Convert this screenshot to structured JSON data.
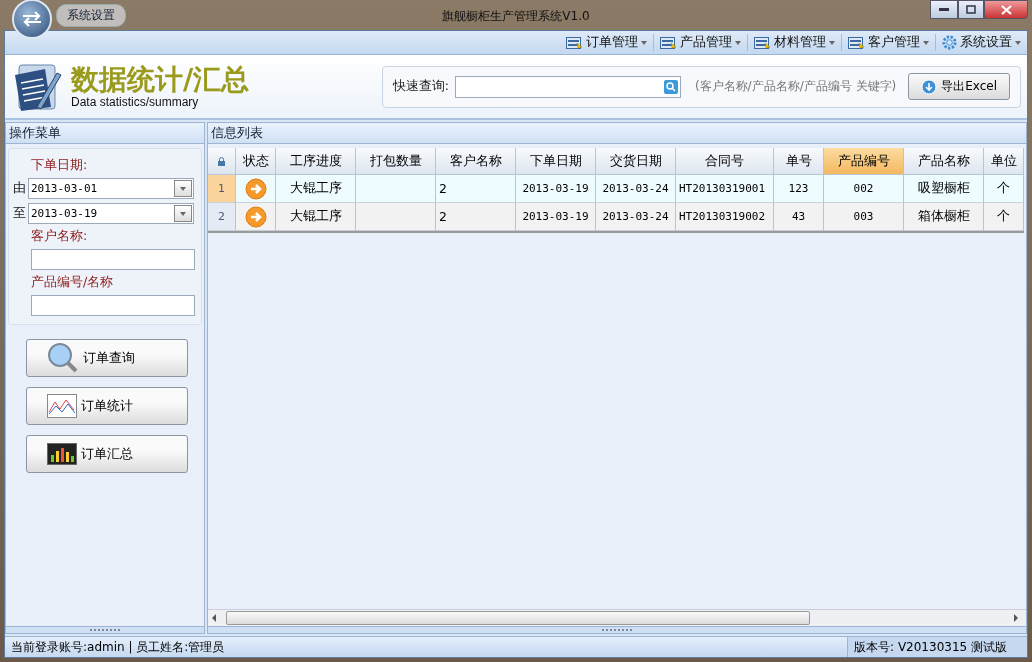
{
  "window": {
    "title": "旗舰橱柜生产管理系统V1.0",
    "quick_menu": "系统设置"
  },
  "menu": [
    {
      "label": "订单管理"
    },
    {
      "label": "产品管理"
    },
    {
      "label": "材料管理"
    },
    {
      "label": "客户管理"
    },
    {
      "label": "系统设置"
    }
  ],
  "header": {
    "title": "数据统计/汇总",
    "subtitle": "Data statistics/summary",
    "search_label": "快速查询:",
    "search_hint": "(客户名称/产品名称/产品编号 关键字)",
    "export_button": "导出Excel"
  },
  "sidebar": {
    "title": "操作菜单",
    "date_label": "下单日期:",
    "from_label": "由",
    "from_value": "2013-03-01",
    "to_label": "至",
    "to_value": "2013-03-19",
    "customer_label": "客户名称:",
    "product_label": "产品编号/名称",
    "buttons": [
      {
        "label": "订单查询"
      },
      {
        "label": "订单统计"
      },
      {
        "label": "订单汇总"
      }
    ]
  },
  "table": {
    "title": "信息列表",
    "status_header": "状态",
    "columns": [
      {
        "label": "工序进度",
        "sorted": false
      },
      {
        "label": "打包数量",
        "sorted": false
      },
      {
        "label": "客户名称",
        "sorted": false
      },
      {
        "label": "下单日期",
        "sorted": false
      },
      {
        "label": "交货日期",
        "sorted": false
      },
      {
        "label": "合同号",
        "sorted": false
      },
      {
        "label": "单号",
        "sorted": false
      },
      {
        "label": "产品编号",
        "sorted": true
      },
      {
        "label": "产品名称",
        "sorted": false
      },
      {
        "label": "单位",
        "sorted": false
      }
    ],
    "rows": [
      {
        "number": "1",
        "selected": true,
        "cells": [
          "大锟工序",
          "",
          "2",
          "2013-03-19",
          "2013-03-24",
          "HT20130319001",
          "123",
          "002",
          "吸塑橱柜",
          "个"
        ]
      },
      {
        "number": "2",
        "selected": false,
        "cells": [
          "大锟工序",
          "",
          "2",
          "2013-03-19",
          "2013-03-24",
          "HT20130319002",
          "43",
          "003",
          "箱体橱柜",
          "个"
        ]
      }
    ]
  },
  "status_bar": {
    "account": "当前登录账号:admin | 员工姓名:管理员",
    "version": "版本号: V20130315 测试版"
  }
}
